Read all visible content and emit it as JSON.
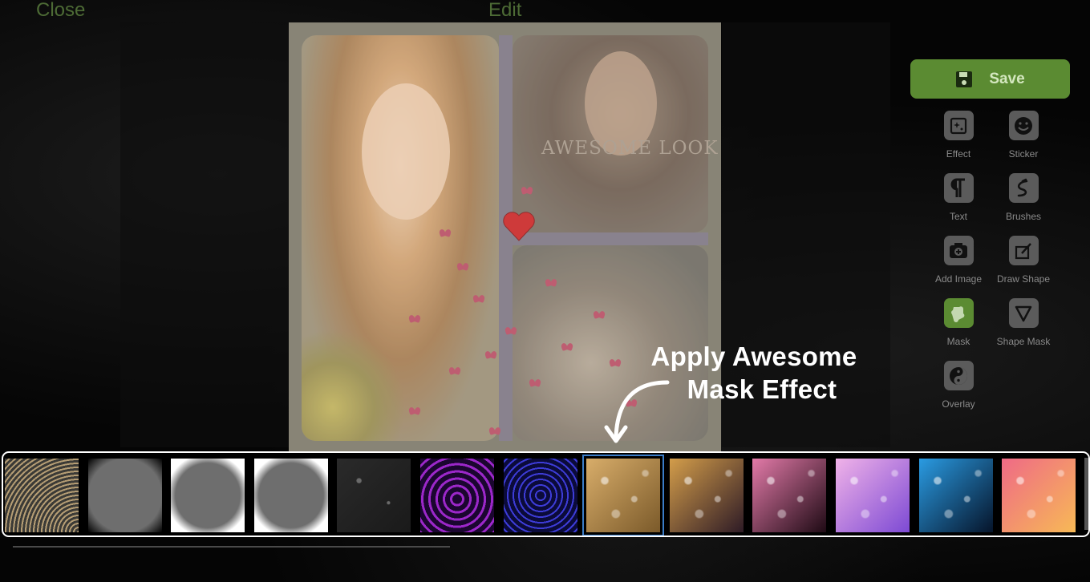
{
  "topbar": {
    "close_label": "Close",
    "edit_label": "Edit"
  },
  "canvas": {
    "text_overlay": "AWESOME LOOK"
  },
  "sidebar": {
    "save_label": "Save",
    "tools": [
      {
        "label": "Effect",
        "icon": "effect-icon",
        "active": false
      },
      {
        "label": "Sticker",
        "icon": "smiley-icon",
        "active": false
      },
      {
        "label": "Text",
        "icon": "pilcrow-icon",
        "active": false
      },
      {
        "label": "Brushes",
        "icon": "brush-squiggle-icon",
        "active": false
      },
      {
        "label": "Add Image",
        "icon": "add-image-icon",
        "active": false
      },
      {
        "label": "Draw Shape",
        "icon": "draw-shape-icon",
        "active": false
      },
      {
        "label": "Mask",
        "icon": "puzzle-mask-icon",
        "active": true
      },
      {
        "label": "Shape Mask",
        "icon": "triangle-icon",
        "active": false
      },
      {
        "label": "Overlay",
        "icon": "yin-yang-icon",
        "active": false
      }
    ]
  },
  "annotation": {
    "line1": "Apply Awesome",
    "line2": "Mask Effect"
  },
  "mask_strip": {
    "selected_index": 7,
    "thumbnails": [
      {
        "name": "star-trails-mask",
        "colors": [
          "#b59d74",
          "#3b3a36"
        ]
      },
      {
        "name": "grunge-gray-mask",
        "colors": [
          "#6e6e6e",
          "#000000"
        ]
      },
      {
        "name": "white-border-mask",
        "colors": [
          "#6e6e6e",
          "#ffffff"
        ]
      },
      {
        "name": "rough-edge-mask",
        "colors": [
          "#6e6e6e",
          "#ffffff"
        ]
      },
      {
        "name": "dark-texture-mask",
        "colors": [
          "#6a6a6a",
          "#1a1a1a"
        ]
      },
      {
        "name": "purple-swirl-mask",
        "colors": [
          "#9b27c9",
          "#1b0630"
        ]
      },
      {
        "name": "blue-rings-mask",
        "colors": [
          "#3d3cd8",
          "#0b0b3a"
        ]
      },
      {
        "name": "golden-hearts-mask",
        "colors": [
          "#d8ad6a",
          "#7b5a2a"
        ]
      },
      {
        "name": "bokeh-hearts-dark-mask",
        "colors": [
          "#d39d4a",
          "#2e1b26"
        ]
      },
      {
        "name": "pink-hearts-mask",
        "colors": [
          "#e27aa8",
          "#1e0a14"
        ]
      },
      {
        "name": "lilac-bokeh-mask",
        "colors": [
          "#f0b2e8",
          "#7d4ad4"
        ]
      },
      {
        "name": "blue-bokeh-mask",
        "colors": [
          "#2a9be2",
          "#06142a"
        ]
      },
      {
        "name": "sunset-hearts-mask",
        "colors": [
          "#ef6a86",
          "#f7b956"
        ]
      }
    ]
  }
}
